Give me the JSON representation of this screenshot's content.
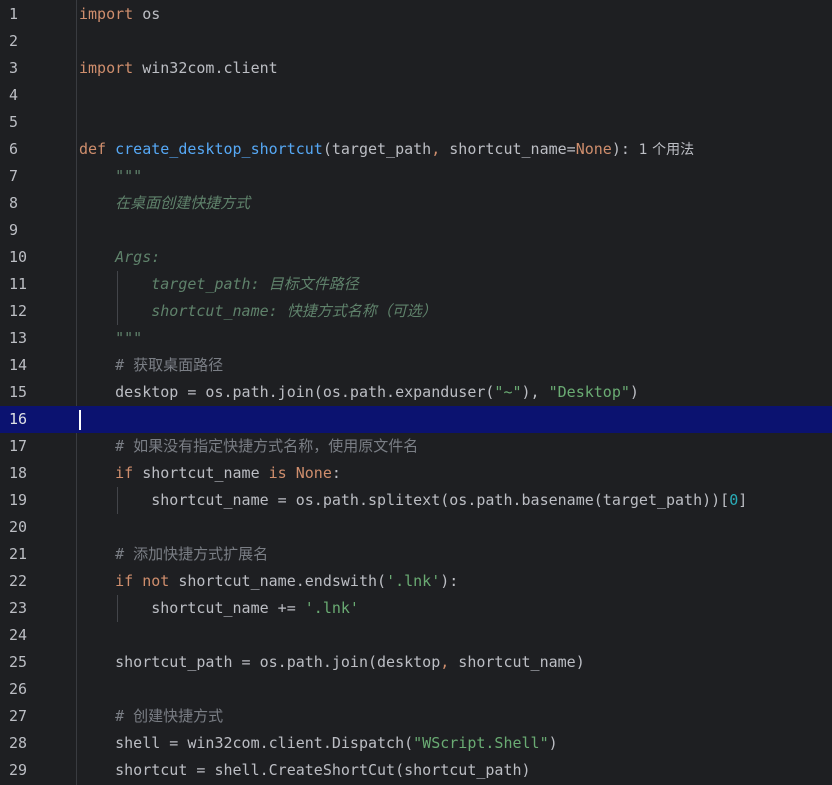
{
  "editor": {
    "language": "python",
    "current_line": 16,
    "lines": [
      {
        "n": "1",
        "parts": [
          [
            "kw",
            "import"
          ],
          [
            "plain",
            " os"
          ]
        ]
      },
      {
        "n": "2",
        "parts": []
      },
      {
        "n": "3",
        "parts": [
          [
            "kw",
            "import"
          ],
          [
            "plain",
            " win32com.client"
          ]
        ]
      },
      {
        "n": "4",
        "parts": []
      },
      {
        "n": "5",
        "parts": []
      },
      {
        "n": "6",
        "parts": [
          [
            "kw",
            "def "
          ],
          [
            "fndef",
            "create_desktop_shortcut"
          ],
          [
            "plain",
            "(target_path"
          ],
          [
            "kw",
            ","
          ],
          [
            "plain",
            " shortcut_name="
          ],
          [
            "kw",
            "None"
          ],
          [
            "plain",
            "):"
          ]
        ],
        "hint": "1 个用法"
      },
      {
        "n": "7",
        "parts": [
          [
            "plain",
            "    "
          ],
          [
            "doc",
            "\"\"\""
          ]
        ]
      },
      {
        "n": "8",
        "parts": [
          [
            "plain",
            "    "
          ],
          [
            "doc",
            "在桌面创建快捷方式"
          ]
        ]
      },
      {
        "n": "9",
        "parts": []
      },
      {
        "n": "10",
        "parts": [
          [
            "plain",
            "    "
          ],
          [
            "doc",
            "Args:"
          ]
        ]
      },
      {
        "n": "11",
        "parts": [
          [
            "plain",
            "        "
          ],
          [
            "doc",
            "target_path: 目标文件路径"
          ]
        ]
      },
      {
        "n": "12",
        "parts": [
          [
            "plain",
            "        "
          ],
          [
            "doc",
            "shortcut_name: 快捷方式名称（可选）"
          ]
        ]
      },
      {
        "n": "13",
        "parts": [
          [
            "plain",
            "    "
          ],
          [
            "doc",
            "\"\"\""
          ]
        ]
      },
      {
        "n": "14",
        "parts": [
          [
            "plain",
            "    "
          ],
          [
            "cmt",
            "# 获取桌面路径"
          ]
        ]
      },
      {
        "n": "15",
        "parts": [
          [
            "plain",
            "    desktop = os.path.join(os.path.expanduser("
          ],
          [
            "str",
            "\"~\""
          ],
          [
            "plain",
            "), "
          ],
          [
            "str",
            "\"Desktop\""
          ],
          [
            "plain",
            ")"
          ]
        ]
      },
      {
        "n": "16",
        "parts": []
      },
      {
        "n": "17",
        "parts": [
          [
            "plain",
            "    "
          ],
          [
            "cmt",
            "# 如果没有指定快捷方式名称，使用原文件名"
          ]
        ]
      },
      {
        "n": "18",
        "parts": [
          [
            "plain",
            "    "
          ],
          [
            "kw",
            "if"
          ],
          [
            "plain",
            " shortcut_name "
          ],
          [
            "kw",
            "is None"
          ],
          [
            "plain",
            ":"
          ]
        ]
      },
      {
        "n": "19",
        "parts": [
          [
            "plain",
            "        shortcut_name = os.path.splitext(os.path.basename(target_path))["
          ],
          [
            "num",
            "0"
          ],
          [
            "plain",
            "]"
          ]
        ]
      },
      {
        "n": "20",
        "parts": []
      },
      {
        "n": "21",
        "parts": [
          [
            "plain",
            "    "
          ],
          [
            "cmt",
            "# 添加快捷方式扩展名"
          ]
        ]
      },
      {
        "n": "22",
        "parts": [
          [
            "plain",
            "    "
          ],
          [
            "kw",
            "if not"
          ],
          [
            "plain",
            " shortcut_name.endswith("
          ],
          [
            "str",
            "'.lnk'"
          ],
          [
            "plain",
            "):"
          ]
        ]
      },
      {
        "n": "23",
        "parts": [
          [
            "plain",
            "        shortcut_name += "
          ],
          [
            "str",
            "'.lnk'"
          ]
        ]
      },
      {
        "n": "24",
        "parts": []
      },
      {
        "n": "25",
        "parts": [
          [
            "plain",
            "    shortcut_path = os.path.join(desktop"
          ],
          [
            "kw",
            ","
          ],
          [
            "plain",
            " shortcut_name)"
          ]
        ]
      },
      {
        "n": "26",
        "parts": []
      },
      {
        "n": "27",
        "parts": [
          [
            "plain",
            "    "
          ],
          [
            "cmt",
            "# 创建快捷方式"
          ]
        ]
      },
      {
        "n": "28",
        "parts": [
          [
            "plain",
            "    shell = win32com.client.Dispatch("
          ],
          [
            "str",
            "\"WScript.Shell\""
          ],
          [
            "plain",
            ")"
          ]
        ]
      },
      {
        "n": "29",
        "parts": [
          [
            "plain",
            "    shortcut = shell.CreateShortCut(shortcut_path)"
          ]
        ]
      }
    ]
  }
}
